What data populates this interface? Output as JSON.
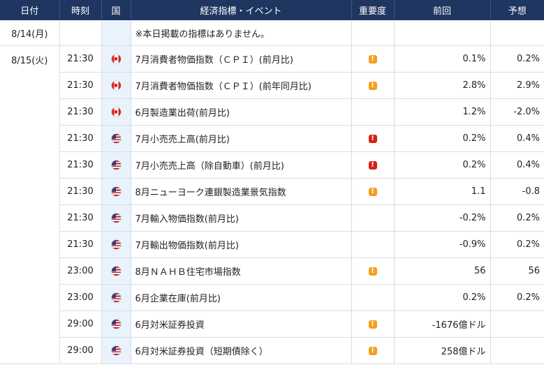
{
  "headers": {
    "date": "日付",
    "time": "時刻",
    "country": "国",
    "indicator": "経済指標・イベント",
    "importance": "重要度",
    "previous": "前回",
    "forecast": "予想"
  },
  "importance_symbol": "!",
  "colors": {
    "header_bg": "#1f3660",
    "flag_column_bg": "#eaf2fb",
    "importance_medium": "#f0a020",
    "importance_high": "#d8201a"
  },
  "row_notice": {
    "date": "8/14(月)",
    "text": "※本日掲載の指標はありません。"
  },
  "date_group": "8/15(火)",
  "events": [
    {
      "time": "21:30",
      "country": "canada-flag-icon",
      "name": "7月消費者物価指数（ＣＰＩ）(前月比)",
      "importance": "medium",
      "previous": "0.1%",
      "forecast": "0.2%"
    },
    {
      "time": "21:30",
      "country": "canada-flag-icon",
      "name": "7月消費者物価指数（ＣＰＩ）(前年同月比)",
      "importance": "medium",
      "previous": "2.8%",
      "forecast": "2.9%"
    },
    {
      "time": "21:30",
      "country": "canada-flag-icon",
      "name": "6月製造業出荷(前月比)",
      "importance": "none",
      "previous": "1.2%",
      "forecast": "-2.0%"
    },
    {
      "time": "21:30",
      "country": "us-flag-icon",
      "name": "7月小売売上高(前月比)",
      "importance": "high",
      "previous": "0.2%",
      "forecast": "0.4%"
    },
    {
      "time": "21:30",
      "country": "us-flag-icon",
      "name": "7月小売売上高（除自動車）(前月比)",
      "importance": "high",
      "previous": "0.2%",
      "forecast": "0.4%"
    },
    {
      "time": "21:30",
      "country": "us-flag-icon",
      "name": "8月ニューヨーク連銀製造業景気指数",
      "importance": "medium",
      "previous": "1.1",
      "forecast": "-0.8"
    },
    {
      "time": "21:30",
      "country": "us-flag-icon",
      "name": "7月輸入物価指数(前月比)",
      "importance": "none",
      "previous": "-0.2%",
      "forecast": "0.2%"
    },
    {
      "time": "21:30",
      "country": "us-flag-icon",
      "name": "7月輸出物価指数(前月比)",
      "importance": "none",
      "previous": "-0.9%",
      "forecast": "0.2%"
    },
    {
      "time": "23:00",
      "country": "us-flag-icon",
      "name": "8月ＮＡＨＢ住宅市場指数",
      "importance": "medium",
      "previous": "56",
      "forecast": "56"
    },
    {
      "time": "23:00",
      "country": "us-flag-icon",
      "name": "6月企業在庫(前月比)",
      "importance": "none",
      "previous": "0.2%",
      "forecast": "0.2%"
    },
    {
      "time": "29:00",
      "country": "us-flag-icon",
      "name": "6月対米証券投資",
      "importance": "medium",
      "previous": "-1676億ドル",
      "forecast": ""
    },
    {
      "time": "29:00",
      "country": "us-flag-icon",
      "name": "6月対米証券投資（短期債除く）",
      "importance": "medium",
      "previous": "258億ドル",
      "forecast": ""
    }
  ]
}
